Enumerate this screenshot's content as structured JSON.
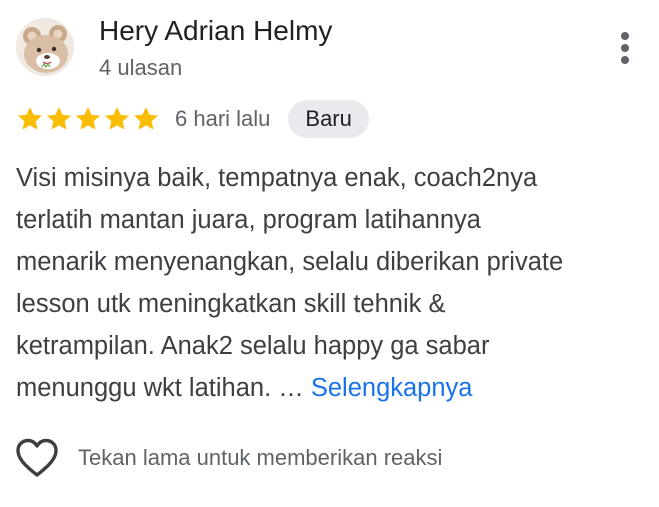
{
  "reviewer": {
    "name": "Hery Adrian Helmy",
    "review_count": "4 ulasan",
    "avatar_icon": "bear-cartoon-avatar"
  },
  "review": {
    "rating": 5,
    "rating_max": 5,
    "star_color": "#fbbc04",
    "date": "6 hari lalu",
    "badge": "Baru",
    "text_lines": [
      "Visi misinya baik, tempatnya enak, coach2nya",
      "terlatih mantan juara, program latihannya",
      "menarik menyenangkan, selalu diberikan private",
      "lesson utk meningkatkan skill tehnik &",
      "ketrampilan. Anak2 selalu happy ga sabar",
      "menunggu wkt latihan. … "
    ],
    "read_more": "Selengkapnya",
    "link_color": "#1a73e8"
  },
  "actions": {
    "more_icon": "more-vertical-icon",
    "reaction_icon": "heart-outline-icon",
    "reaction_hint": "Tekan lama untuk memberikan reaksi"
  }
}
